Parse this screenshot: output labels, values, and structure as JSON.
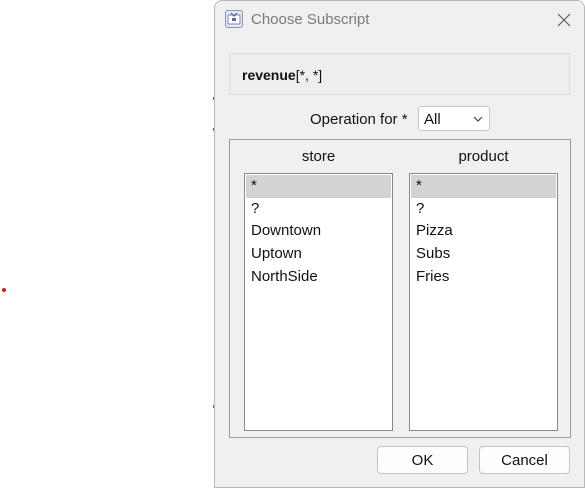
{
  "dialog": {
    "title": "Choose Subscript",
    "app_icon": "subscript-app-icon",
    "close_icon": "close-icon"
  },
  "expression": {
    "name": "revenue",
    "subscript": "[*, *]"
  },
  "operation": {
    "label": "Operation for *",
    "selected": "All",
    "dropdown_icon": "chevron-down-icon"
  },
  "lists": {
    "store": {
      "header": "store",
      "items": [
        "*",
        "?",
        "Downtown",
        "Uptown",
        "NorthSide"
      ],
      "selected_index": 0
    },
    "product": {
      "header": "product",
      "items": [
        "*",
        "?",
        "Pizza",
        "Subs",
        "Fries"
      ],
      "selected_index": 0
    }
  },
  "buttons": {
    "ok": "OK",
    "cancel": "Cancel"
  },
  "colors": {
    "dialog_bg": "#f0f0f0",
    "selection_bg": "#d3d3d3",
    "marker_red": "#d11a1a"
  }
}
